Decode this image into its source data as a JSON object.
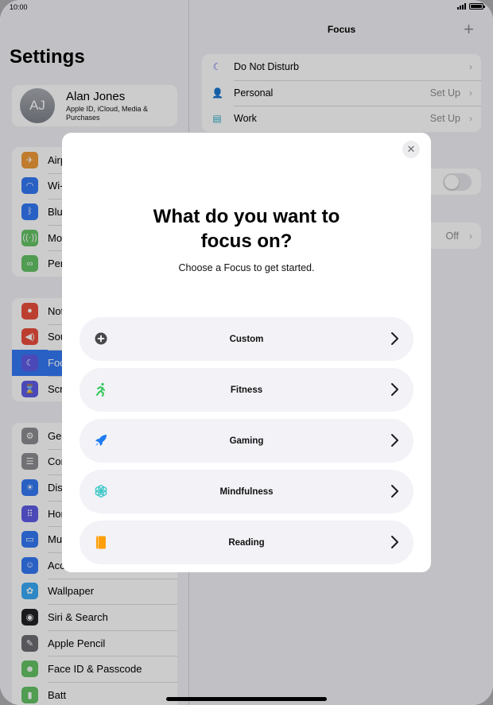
{
  "status_bar": {
    "time": "10:00"
  },
  "sidebar": {
    "title": "Settings",
    "profile": {
      "initials": "AJ",
      "name": "Alan Jones",
      "subtitle": "Apple ID, iCloud, Media & Purchases"
    },
    "group1": [
      {
        "label": "Airp",
        "icon": "airplane-icon",
        "color": "#f09a37",
        "glyph": "✈"
      },
      {
        "label": "Wi-",
        "icon": "wifi-icon",
        "color": "#3478f6",
        "glyph": "◠"
      },
      {
        "label": "Blu",
        "icon": "bluetooth-icon",
        "color": "#3478f6",
        "glyph": "ᛒ"
      },
      {
        "label": "Mo",
        "icon": "antenna-icon",
        "color": "#65c466",
        "glyph": "((·))"
      },
      {
        "label": "Per",
        "icon": "hotspot-icon",
        "color": "#65c466",
        "glyph": "∞"
      }
    ],
    "group2": [
      {
        "label": "Not",
        "icon": "notifications-icon",
        "color": "#eb4e3d",
        "glyph": "●"
      },
      {
        "label": "Sou",
        "icon": "speaker-icon",
        "color": "#eb4e3d",
        "glyph": "◀)"
      },
      {
        "label": "Foc",
        "icon": "moon-icon",
        "color": "#5e5ce6",
        "glyph": "☾",
        "selected": true
      },
      {
        "label": "Scr",
        "icon": "hourglass-icon",
        "color": "#5e5ce6",
        "glyph": "⌛"
      }
    ],
    "group3": [
      {
        "label": "Ger",
        "icon": "gear-icon",
        "color": "#8e8e93",
        "glyph": "⚙"
      },
      {
        "label": "Cor",
        "icon": "switches-icon",
        "color": "#8e8e93",
        "glyph": "☰"
      },
      {
        "label": "Dis",
        "icon": "brightness-icon",
        "color": "#3478f6",
        "glyph": "☀"
      },
      {
        "label": "Hor App",
        "icon": "home-screen-icon",
        "color": "#5e5ce6",
        "glyph": "⠿"
      },
      {
        "label": "Mu",
        "icon": "multitasking-icon",
        "color": "#3478f6",
        "glyph": "▭"
      },
      {
        "label": "Accessibility",
        "icon": "accessibility-icon",
        "color": "#3478f6",
        "glyph": "☺"
      },
      {
        "label": "Wallpaper",
        "icon": "flower-icon",
        "color": "#39aaf7",
        "glyph": "✿"
      },
      {
        "label": "Siri & Search",
        "icon": "siri-icon",
        "color": "#222226",
        "glyph": "◉"
      },
      {
        "label": "Apple Pencil",
        "icon": "pencil-icon",
        "color": "#6d6d72",
        "glyph": "✎"
      },
      {
        "label": "Face ID & Passcode",
        "icon": "face-id-icon",
        "color": "#65c466",
        "glyph": "☻"
      },
      {
        "label": "Batt",
        "icon": "battery-icon",
        "color": "#65c466",
        "glyph": "▮"
      }
    ]
  },
  "detail": {
    "title": "Focus",
    "add_label": "+",
    "focus_items": [
      {
        "label": "Do Not Disturb",
        "value": "",
        "icon": "moon-icon",
        "color": "#5e5ce6",
        "glyph": "☾"
      },
      {
        "label": "Personal",
        "value": "Set Up",
        "icon": "person-icon",
        "color": "#af52de",
        "glyph": "👤"
      },
      {
        "label": "Work",
        "value": "Set Up",
        "icon": "badge-icon",
        "color": "#30b0c7",
        "glyph": "▤"
      }
    ],
    "status_value": "Off"
  },
  "modal": {
    "title_line1": "What do you want to",
    "title_line2": "focus on?",
    "subtitle": "Choose a Focus to get started.",
    "options": [
      {
        "label": "Custom",
        "icon": "plus-circle-icon",
        "color": "#48484a"
      },
      {
        "label": "Fitness",
        "icon": "running-icon",
        "color": "#34c759"
      },
      {
        "label": "Gaming",
        "icon": "rocket-icon",
        "color": "#1e7bf0"
      },
      {
        "label": "Mindfulness",
        "icon": "mindfulness-flower-icon",
        "color": "#40c8c8"
      },
      {
        "label": "Reading",
        "icon": "book-icon",
        "color": "#ff9f0a"
      }
    ]
  }
}
